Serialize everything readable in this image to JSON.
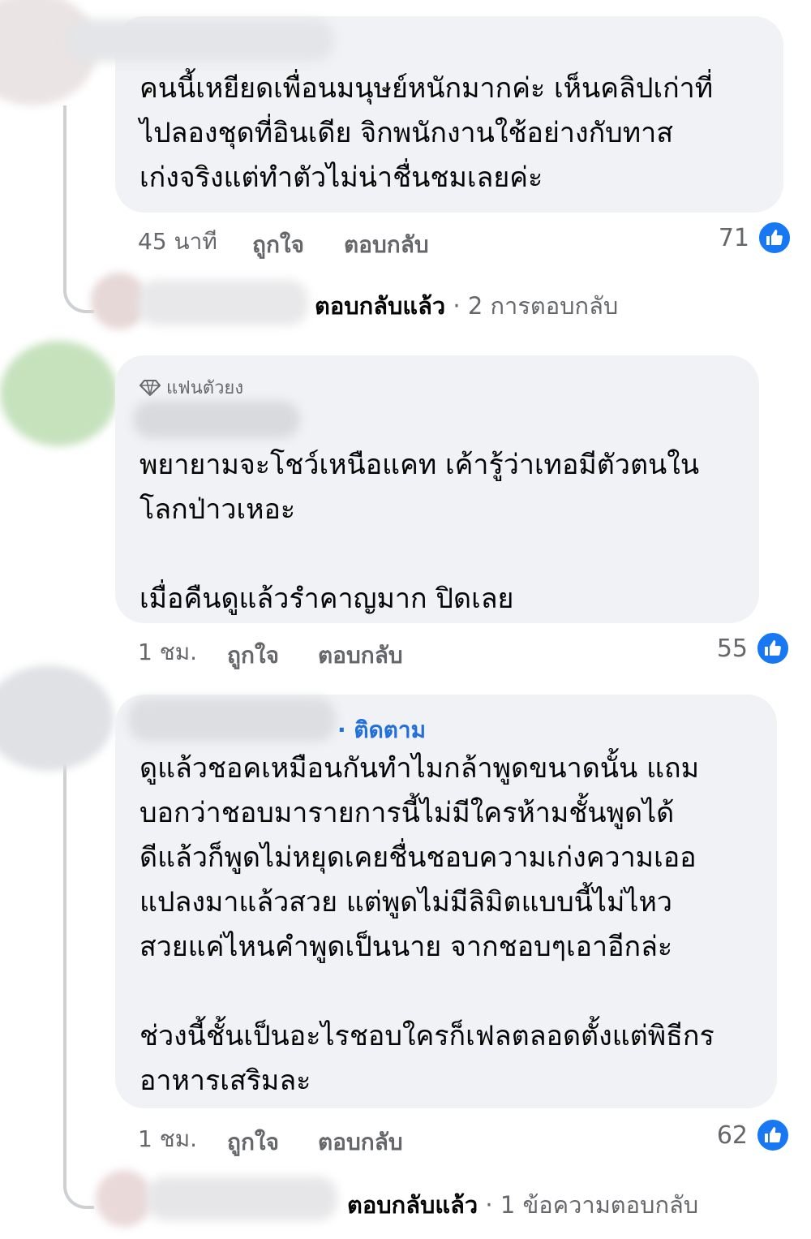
{
  "comments": [
    {
      "text": "คนนี้เหยียดเพื่อนมนุษย์หนักมากค่ะ เห็นคลิปเก่าที่\nไปลองชุดที่อินเดีย จิกพนักงานใช้อย่างกับทาส\nเก่งจริงแต่ทำตัวไม่น่าชื่นชมเลยค่ะ",
      "time": "45 นาที",
      "like_label": "ถูกใจ",
      "reply_label": "ตอบกลับ",
      "reaction_count": "71",
      "replies": {
        "replied_label": "ตอบกลับแล้ว",
        "separator": "·",
        "count_label": "2 การตอบกลับ"
      }
    },
    {
      "badge": "แฟนตัวยง",
      "text": "พยายามจะโชว์เหนือแคท เค้ารู้ว่าเทอมีตัวตนใน\nโลกป่าวเหอะ\n\nเมื่อคืนดูแล้วรำคาญมาก ปิดเลย",
      "time": "1 ชม.",
      "like_label": "ถูกใจ",
      "reply_label": "ตอบกลับ",
      "reaction_count": "55"
    },
    {
      "follow_label": "· ติดตาม",
      "text": "ดูแล้วชอคเหมือนกันทำไมกล้าพูดขนาดนั้น แถม\nบอกว่าชอบมารายการนี้ไม่มีใครห้ามชั้นพูดได้\nดีแล้วก็พูดไม่หยุดเคยชื่นชอบความเก่งความเออ\nแปลงมาแล้วสวย แต่พูดไม่มีลิมิตแบบนี้ไม่ไหว\nสวยแค่ไหนคำพูดเป็นนาย จากชอบๆเอาอีกล่ะ\n\nช่วงนี้ชั้นเป็นอะไรชอบใครก็เฟลตลอดตั้งแต่พิธีกร\nอาหารเสริมละ",
      "time": "1 ชม.",
      "like_label": "ถูกใจ",
      "reply_label": "ตอบกลับ",
      "reaction_count": "62",
      "replies": {
        "replied_label": "ตอบกลับแล้ว",
        "separator": "·",
        "count_label": "1 ข้อความตอบกลับ"
      }
    }
  ],
  "icons": {
    "reaction": "like-thumb-icon",
    "badge": "diamond-icon"
  },
  "colors": {
    "bubble": "#f0f2f5",
    "like_blue": "#1877f2",
    "follow_blue": "#216fdb",
    "meta_gray": "#65676b"
  }
}
